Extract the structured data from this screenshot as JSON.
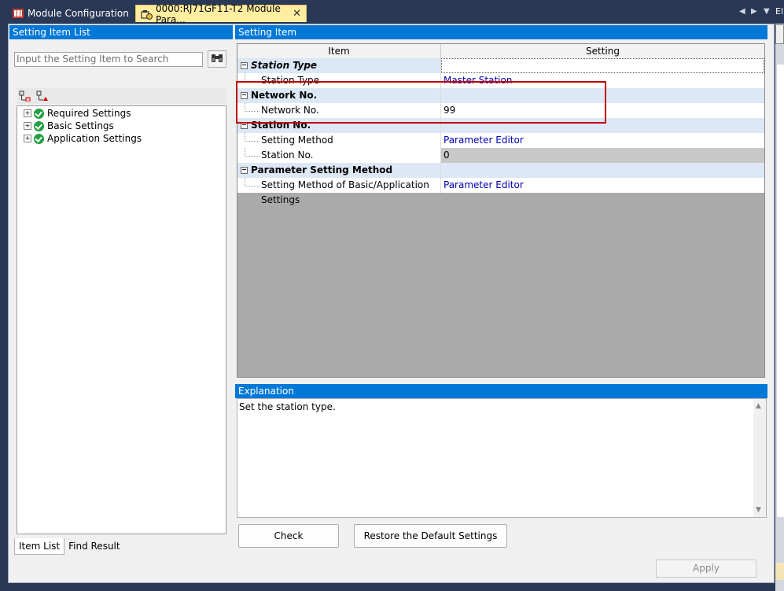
{
  "tabs": {
    "inactive_label": "Module Configuration",
    "active_label": "0000:RJ71GF11-T2 Module Para...",
    "close_glyph": "✕"
  },
  "right_strip": {
    "top_text": "El"
  },
  "left_panel": {
    "title": "Setting Item List",
    "search_placeholder": "Input the Setting Item to Search",
    "tree": [
      {
        "label": "Required Settings"
      },
      {
        "label": "Basic Settings"
      },
      {
        "label": "Application Settings"
      }
    ],
    "bottom_tabs": [
      "Item List",
      "Find Result"
    ]
  },
  "right_panel": {
    "title": "Setting Item",
    "columns": {
      "item": "Item",
      "setting": "Setting"
    },
    "rows": [
      {
        "type": "cat",
        "item": "Station Type",
        "setting": "",
        "italic": true
      },
      {
        "type": "sub",
        "item": "Station Type",
        "setting": "Master Station"
      },
      {
        "type": "cat",
        "item": "Network No.",
        "setting": ""
      },
      {
        "type": "sub",
        "item": "Network No.",
        "setting": "99"
      },
      {
        "type": "cat",
        "item": "Station No.",
        "setting": ""
      },
      {
        "type": "sub",
        "item": "Setting Method",
        "setting": "Parameter Editor"
      },
      {
        "type": "sub",
        "item": "Station No.",
        "setting": "0"
      },
      {
        "type": "cat",
        "item": "Parameter Setting Method",
        "setting": ""
      },
      {
        "type": "sub",
        "item": "Setting Method of Basic/Application Settings",
        "setting": "Parameter Editor"
      }
    ],
    "explanation_title": "Explanation",
    "explanation_text": "Set the station type."
  },
  "buttons": {
    "check": "Check",
    "restore": "Restore the Default Settings",
    "apply": "Apply"
  },
  "colors": {
    "accent": "#0078d7",
    "highlight_box": "#c00000",
    "active_tab": "#ffeda0",
    "background": "#293955"
  }
}
